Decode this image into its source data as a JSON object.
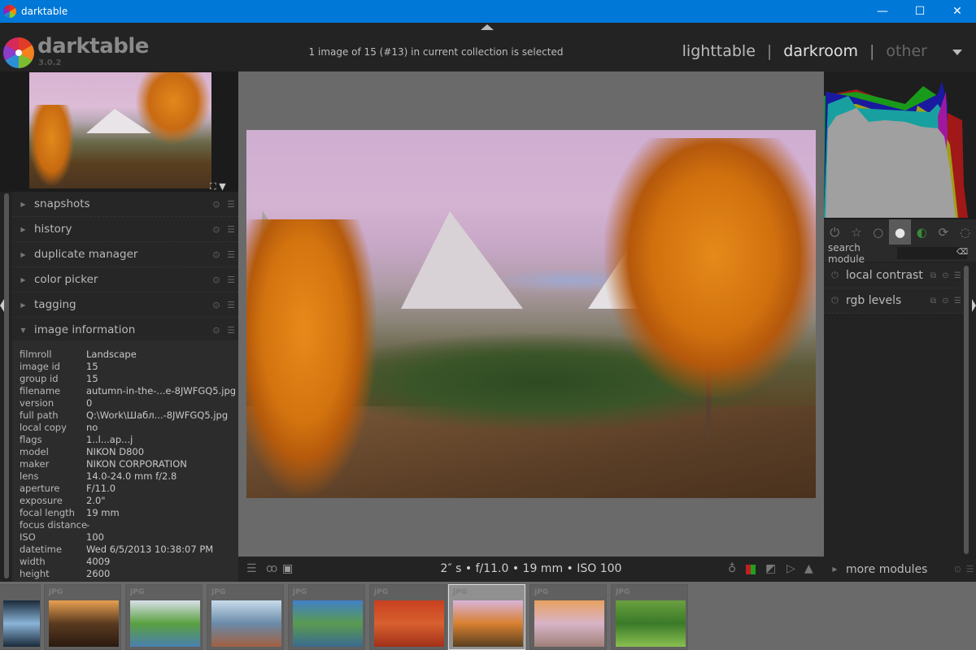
{
  "window": {
    "title": "darktable",
    "minimize": "—",
    "maximize": "☐",
    "close": "✕"
  },
  "header": {
    "brand": "darktable",
    "version": "3.0.2",
    "selection_info": "1 image of 15 (#13) in current collection is selected",
    "views": {
      "lighttable": "lighttable",
      "separator": "|",
      "darkroom": "darkroom",
      "other": "other",
      "active": "darkroom"
    }
  },
  "left_panel": {
    "navigation_icons": {
      "fit": "⛶",
      "menu": "▼"
    },
    "modules": [
      {
        "label": "snapshots",
        "expanded": false
      },
      {
        "label": "history",
        "expanded": false
      },
      {
        "label": "duplicate manager",
        "expanded": false
      },
      {
        "label": "color picker",
        "expanded": false
      },
      {
        "label": "tagging",
        "expanded": false
      },
      {
        "label": "image information",
        "expanded": true
      }
    ],
    "image_information": [
      {
        "key": "filmroll",
        "value": "Landscape"
      },
      {
        "key": "image id",
        "value": "15"
      },
      {
        "key": "group id",
        "value": "15"
      },
      {
        "key": "filename",
        "value": "autumn-in-the-...e-8JWFGQ5.jpg"
      },
      {
        "key": "version",
        "value": "0"
      },
      {
        "key": "full path",
        "value": " Q:\\Work\\Шабл...-8JWFGQ5.jpg"
      },
      {
        "key": "local copy",
        "value": "no"
      },
      {
        "key": "flags",
        "value": "1..l...ap...j"
      },
      {
        "key": "model",
        "value": "NIKON D800"
      },
      {
        "key": "maker",
        "value": "NIKON CORPORATION"
      },
      {
        "key": "lens",
        "value": "14.0-24.0 mm f/2.8"
      },
      {
        "key": "aperture",
        "value": "F/11.0"
      },
      {
        "key": "exposure",
        "value": "2.0\""
      },
      {
        "key": "focal length",
        "value": "19 mm"
      },
      {
        "key": "focus distance",
        "value": "-"
      },
      {
        "key": "ISO",
        "value": "100"
      },
      {
        "key": "datetime",
        "value": "Wed 6/5/2013 10:38:07 PM"
      },
      {
        "key": "width",
        "value": "4009"
      },
      {
        "key": "height",
        "value": "2600"
      }
    ]
  },
  "center": {
    "exif_summary": "2″ s • f/11.0 • 19 mm • ISO 100",
    "bottom_left_icons": [
      "presets-icon",
      "styles-icon",
      "second-window-icon"
    ],
    "bottom_right_icons": [
      "focus-peaking-icon",
      "color-assessment-icon",
      "raw-overexposed-icon",
      "clipping-icon",
      "softproof-icon",
      "gamut-check-icon"
    ]
  },
  "right_panel": {
    "module_groups": [
      {
        "name": "active-modules",
        "glyph": "⏻"
      },
      {
        "name": "favorites",
        "glyph": "☆"
      },
      {
        "name": "basic",
        "glyph": "○"
      },
      {
        "name": "tone",
        "glyph": "●",
        "active": true
      },
      {
        "name": "color",
        "glyph": "◐"
      },
      {
        "name": "correct",
        "glyph": "⟳"
      },
      {
        "name": "effect",
        "glyph": "◌"
      }
    ],
    "search": {
      "label": "search module",
      "value": "",
      "placeholder": ""
    },
    "modules": [
      {
        "label": "local contrast"
      },
      {
        "label": "rgb levels"
      }
    ],
    "more_modules": "more modules"
  },
  "filmstrip": {
    "thumbnails": [
      {
        "format": "",
        "colors": [
          "#1a2a3a",
          "#8ab4d8",
          "#1a2a3a"
        ]
      },
      {
        "format": "JPG",
        "colors": [
          "#e8a050",
          "#5a3a20",
          "#2a1a10"
        ]
      },
      {
        "format": "JPG",
        "colors": [
          "#d8e0e8",
          "#5aa040",
          "#4a80b0"
        ]
      },
      {
        "format": "JPG",
        "colors": [
          "#c8dcec",
          "#6a8aa8",
          "#a06040"
        ]
      },
      {
        "format": "JPG",
        "colors": [
          "#4080c8",
          "#5a9a50",
          "#3a6a90"
        ]
      },
      {
        "format": "JPG",
        "colors": [
          "#c84020",
          "#d86030",
          "#a03018"
        ]
      },
      {
        "format": "JPG",
        "colors": [
          "#d8b4d8",
          "#d88030",
          "#5a4020"
        ],
        "selected": true
      },
      {
        "format": "JPG",
        "colors": [
          "#e8a060",
          "#d8b4c8",
          "#a08078"
        ]
      },
      {
        "format": "JPG",
        "colors": [
          "#6aa040",
          "#3a7a28",
          "#8ac050"
        ]
      }
    ]
  },
  "histogram": {
    "channels": [
      "red",
      "green",
      "blue"
    ],
    "colors": {
      "gray": "#a0a0a0",
      "red": "#a01818",
      "green": "#18a018",
      "blue": "#1818a0",
      "yellow": "#a0a018",
      "cyan": "#18a0a0",
      "magenta": "#a018a0"
    }
  },
  "accent": {
    "titlebar": "#0078d7"
  }
}
